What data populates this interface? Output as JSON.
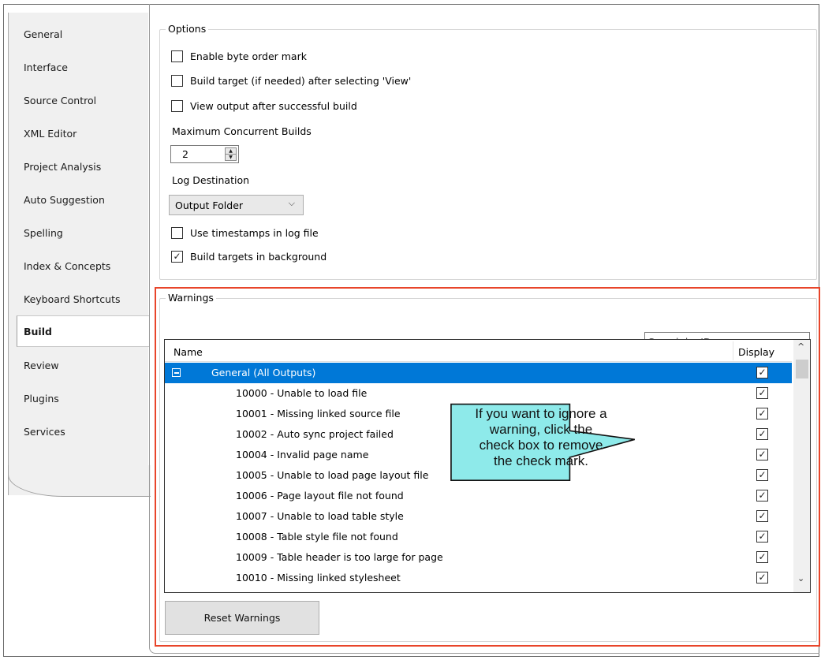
{
  "sidebar": {
    "items": [
      {
        "label": "General"
      },
      {
        "label": "Interface"
      },
      {
        "label": "Source Control"
      },
      {
        "label": "XML Editor"
      },
      {
        "label": "Project Analysis"
      },
      {
        "label": "Auto Suggestion"
      },
      {
        "label": "Spelling"
      },
      {
        "label": "Index & Concepts"
      },
      {
        "label": "Keyboard Shortcuts"
      },
      {
        "label": "Build"
      },
      {
        "label": "Review"
      },
      {
        "label": "Plugins"
      },
      {
        "label": "Services"
      }
    ],
    "active": "Build"
  },
  "options": {
    "title": "Options",
    "enable_bom": {
      "label": "Enable byte order mark",
      "checked": false
    },
    "build_target": {
      "label": "Build target (if needed) after selecting 'View'",
      "checked": false
    },
    "view_output": {
      "label": "View output after successful build",
      "checked": false
    },
    "max_builds_label": "Maximum Concurrent Builds",
    "max_builds_value": "2",
    "log_dest_label": "Log Destination",
    "log_dest_value": "Output Folder",
    "timestamps": {
      "label": "Use timestamps in log file",
      "checked": false
    },
    "background": {
      "label": "Build targets in background",
      "checked": true
    }
  },
  "warnings": {
    "title": "Warnings",
    "search_placeholder": "Search by ID",
    "columns": {
      "name": "Name",
      "display": "Display"
    },
    "group_label": "General (All Outputs)",
    "rows": [
      {
        "text": "10000 - Unable to load file",
        "checked": true
      },
      {
        "text": "10001 - Missing linked source file",
        "checked": true
      },
      {
        "text": "10002 - Auto sync project failed",
        "checked": true
      },
      {
        "text": "10004 - Invalid page name",
        "checked": true
      },
      {
        "text": "10005 - Unable to load page layout file",
        "checked": true
      },
      {
        "text": "10006 - Page layout file not found",
        "checked": true
      },
      {
        "text": "10007 - Unable to load table style",
        "checked": true
      },
      {
        "text": "10008 - Table style file not found",
        "checked": true
      },
      {
        "text": "10009 - Table header is too large for page",
        "checked": true
      },
      {
        "text": "10010 - Missing linked stylesheet",
        "checked": true
      }
    ],
    "reset_label": "Reset Warnings"
  },
  "callout": {
    "line1": "If you want to ignore a",
    "line2": "warning, click the",
    "line3": "check box to remove",
    "line4": "the check mark."
  },
  "colors": {
    "selection": "#0078d7",
    "highlight_border": "#e8452a",
    "callout_fill": "#8eeaea"
  },
  "glyphs": {
    "check": "✓",
    "chevron_down": "⌵",
    "up": "▲",
    "down": "▼",
    "scroll_up": "^",
    "scroll_down": "⌄"
  }
}
